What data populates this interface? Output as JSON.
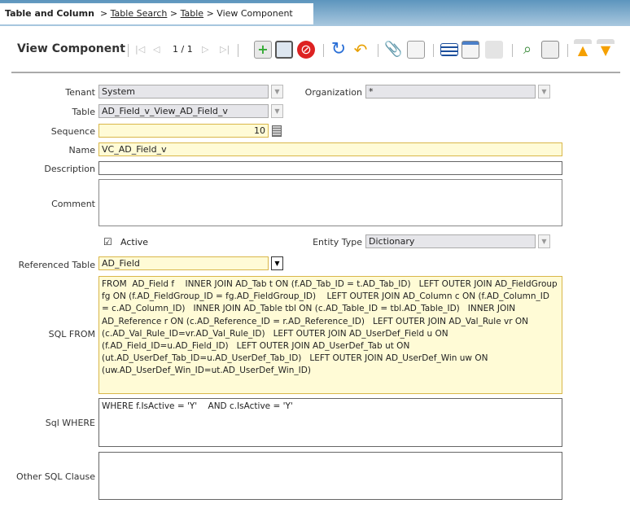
{
  "breadcrumb": {
    "root": "Table and Column",
    "items": [
      "Table Search",
      "Table"
    ],
    "current": "View Component",
    "sep": ">"
  },
  "toolbar": {
    "title": "View Component",
    "record": "1 / 1",
    "icons": [
      "first-record-icon",
      "previous-record-icon",
      "next-record-icon",
      "last-record-icon",
      "new-record-icon",
      "save-icon",
      "delete-icon",
      "refresh-icon",
      "undo-icon",
      "attachment-icon",
      "chat-icon",
      "grid-toggle-icon",
      "report-icon",
      "print-icon",
      "zoom-across-icon",
      "archive-icon",
      "parent-record-icon",
      "detail-record-icon"
    ]
  },
  "colors": {
    "accent": "#5d95bd",
    "required": "#fffbd6",
    "readonly": "#e6e6ea"
  },
  "form": {
    "tenant": {
      "label": "Tenant",
      "value": "System"
    },
    "organization": {
      "label": "Organization",
      "value": "*"
    },
    "table": {
      "label": "Table",
      "value": "AD_Field_v_View_AD_Field_v"
    },
    "sequence": {
      "label": "Sequence",
      "value": "10"
    },
    "name": {
      "label": "Name",
      "value": "VC_AD_Field_v"
    },
    "description": {
      "label": "Description",
      "value": ""
    },
    "comment": {
      "label": "Comment",
      "value": ""
    },
    "active": {
      "label": "Active",
      "checked": true
    },
    "entity_type": {
      "label": "Entity Type",
      "value": "Dictionary"
    },
    "referenced_table": {
      "label": "Referenced Table",
      "value": "AD_Field"
    },
    "sql_from": {
      "label": "SQL FROM",
      "value": "FROM  AD_Field f    INNER JOIN AD_Tab t ON (f.AD_Tab_ID = t.AD_Tab_ID)   LEFT OUTER JOIN AD_FieldGroup fg ON (f.AD_FieldGroup_ID = fg.AD_FieldGroup_ID)    LEFT OUTER JOIN AD_Column c ON (f.AD_Column_ID = c.AD_Column_ID)   INNER JOIN AD_Table tbl ON (c.AD_Table_ID = tbl.AD_Table_ID)   INNER JOIN AD_Reference r ON (c.AD_Reference_ID = r.AD_Reference_ID)   LEFT OUTER JOIN AD_Val_Rule vr ON (c.AD_Val_Rule_ID=vr.AD_Val_Rule_ID)   LEFT OUTER JOIN AD_UserDef_Field u ON (f.AD_Field_ID=u.AD_Field_ID)   LEFT OUTER JOIN AD_UserDef_Tab ut ON (ut.AD_UserDef_Tab_ID=u.AD_UserDef_Tab_ID)   LEFT OUTER JOIN AD_UserDef_Win uw ON (uw.AD_UserDef_Win_ID=ut.AD_UserDef_Win_ID)"
    },
    "sql_where": {
      "label": "Sql WHERE",
      "value": "WHERE f.IsActive = 'Y'    AND c.IsActive = 'Y'"
    },
    "other_sql": {
      "label": "Other SQL Clause",
      "value": ""
    }
  }
}
